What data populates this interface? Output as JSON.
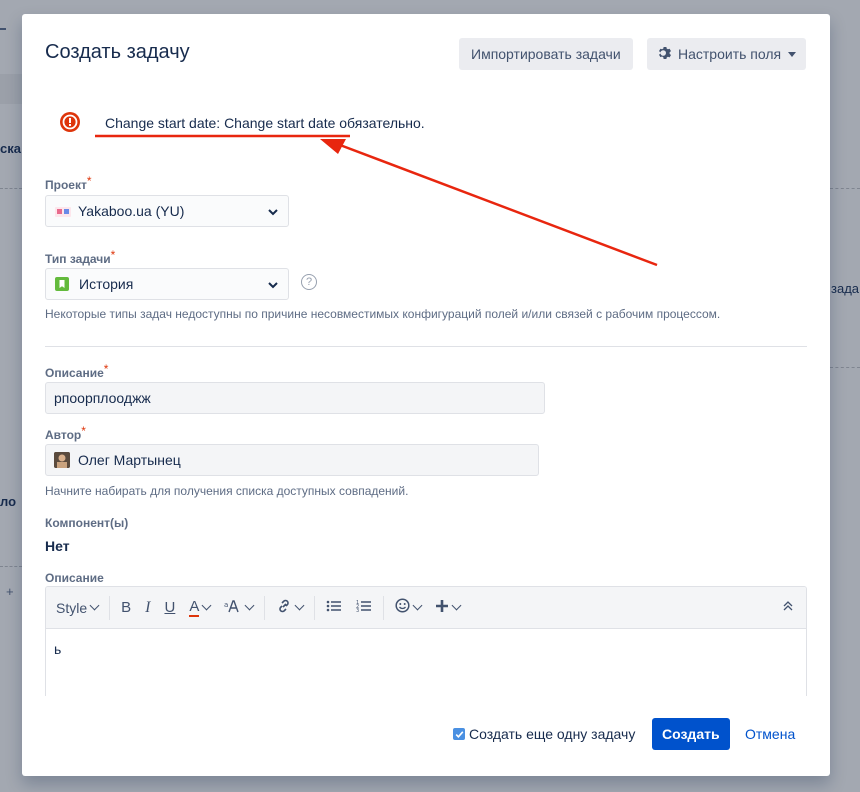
{
  "background": {
    "frag1": "ска",
    "frag2": "зада",
    "frag3": "ло",
    "frag4": "+"
  },
  "dialog": {
    "title": "Создать задачу",
    "import_label": "Импортировать задачи",
    "configure_label": "Настроить поля"
  },
  "error": {
    "message": "Change start date: Change start date обязательно."
  },
  "project": {
    "label": "Проект",
    "value": "Yakaboo.ua (YU)"
  },
  "issue_type": {
    "label": "Тип задачи",
    "value": "История",
    "help": "Некоторые типы задач недоступны по причине несовместимых конфигураций полей и/или связей с рабочим процессом."
  },
  "summary": {
    "label": "Описание",
    "value": "рпоорплооджж"
  },
  "reporter": {
    "label": "Автор",
    "value": "Олег Мартынец",
    "help": "Начните набирать для получения списка доступных совпадений."
  },
  "components": {
    "label": "Компонент(ы)",
    "value": "Нет"
  },
  "description": {
    "label": "Описание",
    "toolbar": {
      "style_label": "Style",
      "bold": "B",
      "italic": "I",
      "underline": "U",
      "text_color": "A"
    },
    "body": "ь"
  },
  "footer": {
    "create_another_label": "Создать еще одну задачу",
    "create_another_checked": true,
    "create_label": "Создать",
    "cancel_label": "Отмена"
  },
  "colors": {
    "primary": "#0052cc",
    "error": "#de350b",
    "annotation": "#e8260f"
  }
}
